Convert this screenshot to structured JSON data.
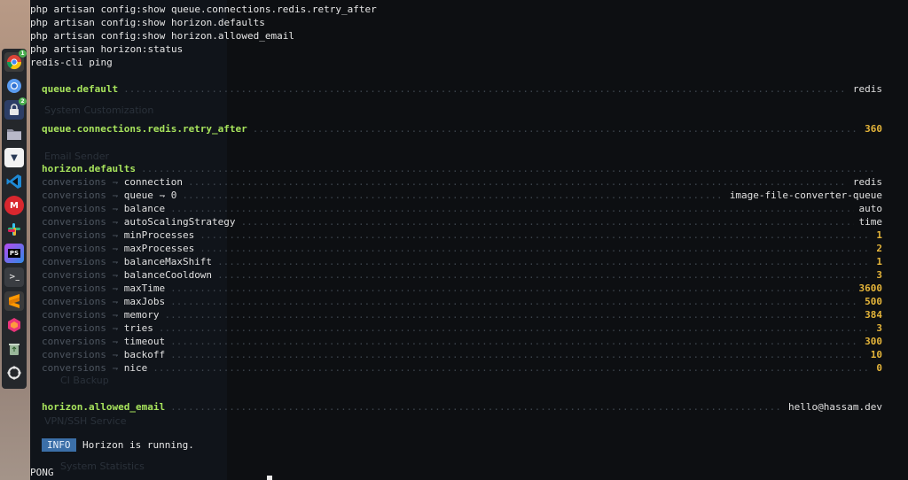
{
  "commands": [
    "php artisan config:show queue.connections.redis.retry_after",
    "php artisan config:show horizon.defaults",
    "php artisan config:show horizon.allowed_email",
    "php artisan horizon:status",
    "redis-cli ping"
  ],
  "queue_default": {
    "key": "queue.default",
    "value": "redis"
  },
  "retry_after": {
    "key": "queue.connections.redis.retry_after",
    "value": "360"
  },
  "horizon_defaults": {
    "key": "horizon.defaults",
    "prefix": "conversions",
    "arrow": "⇁",
    "items": [
      {
        "key": "connection",
        "value": "redis"
      },
      {
        "key": "queue ⇁ 0",
        "value": "image-file-converter-queue"
      },
      {
        "key": "balance",
        "value": "auto"
      },
      {
        "key": "autoScalingStrategy",
        "value": "time"
      },
      {
        "key": "minProcesses",
        "value": "1"
      },
      {
        "key": "maxProcesses",
        "value": "2"
      },
      {
        "key": "balanceMaxShift",
        "value": "1"
      },
      {
        "key": "balanceCooldown",
        "value": "3"
      },
      {
        "key": "maxTime",
        "value": "3600"
      },
      {
        "key": "maxJobs",
        "value": "500"
      },
      {
        "key": "memory",
        "value": "384"
      },
      {
        "key": "tries",
        "value": "3"
      },
      {
        "key": "timeout",
        "value": "300"
      },
      {
        "key": "backoff",
        "value": "10"
      },
      {
        "key": "nice",
        "value": "0"
      }
    ]
  },
  "allowed_email": {
    "key": "horizon.allowed_email",
    "value": "hello@hassam.dev"
  },
  "status": {
    "badge": "INFO",
    "message": "Horizon is running."
  },
  "ping_reply": "PONG",
  "background": {
    "system_customization": "System Customization",
    "email_sender": "Email Sender",
    "ci_backup": "CI Backup",
    "vpn_service": "VPN/SSH Service",
    "system_statistics": "System Statistics"
  },
  "dock": [
    {
      "icon": "chrome-icon",
      "badge": "1"
    },
    {
      "icon": "chromium-icon"
    },
    {
      "icon": "lock-app-icon",
      "badge": "2"
    },
    {
      "icon": "files-icon"
    },
    {
      "icon": "editor-icon"
    },
    {
      "icon": "vscode-icon"
    },
    {
      "icon": "mega-icon"
    },
    {
      "icon": "slack-icon"
    },
    {
      "icon": "phpstorm-icon"
    },
    {
      "icon": "terminal-icon"
    },
    {
      "icon": "sublime-icon"
    },
    {
      "icon": "kubernetes-icon"
    },
    {
      "icon": "trash-icon"
    },
    {
      "icon": "apps-grid-icon"
    }
  ],
  "colors": {
    "terminal_bg": "#0d0f12",
    "section_green": "#a7e35c",
    "number_yellow": "#e5b53a",
    "info_blue": "#3b6fa8"
  }
}
